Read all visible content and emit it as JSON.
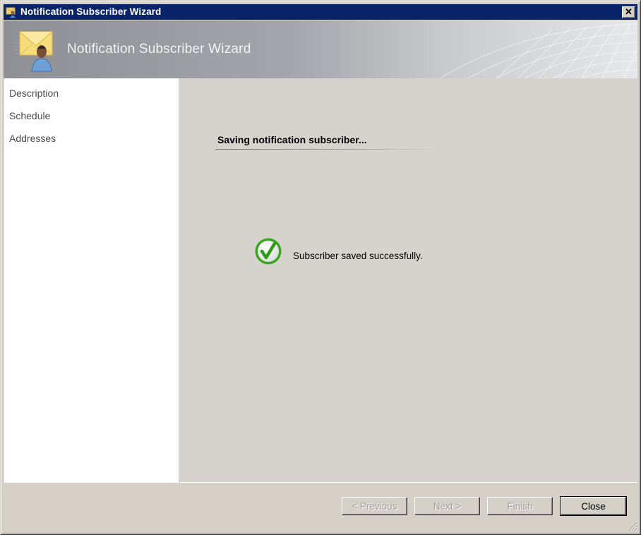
{
  "window": {
    "title": "Notification Subscriber Wizard",
    "title_icon": "wizard-app-icon",
    "close_glyph": "✕"
  },
  "banner": {
    "title": "Notification Subscriber Wizard",
    "icon": "envelope-user-icon"
  },
  "sidebar": {
    "items": [
      {
        "label": "Description"
      },
      {
        "label": "Schedule"
      },
      {
        "label": "Addresses"
      }
    ]
  },
  "main": {
    "heading": "Saving notification subscriber...",
    "status_icon": "success-check-icon",
    "status_text": "Subscriber saved successfully."
  },
  "footer": {
    "buttons": [
      {
        "label": "< Previous",
        "enabled": false
      },
      {
        "label": "Next >",
        "enabled": false
      },
      {
        "label": "Finish",
        "enabled": false
      },
      {
        "label": "Close",
        "enabled": true
      }
    ]
  },
  "colors": {
    "titlebar": "#0a246a",
    "success_green": "#3ca41e",
    "content_bg": "#d6d3ce"
  }
}
